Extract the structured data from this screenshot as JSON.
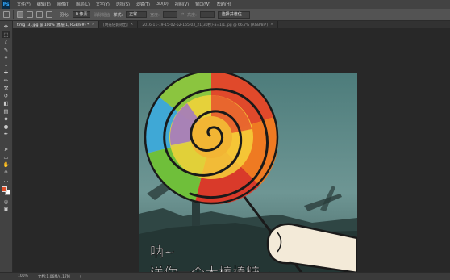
{
  "app": {
    "logo_text": "Ps"
  },
  "menu": [
    "文件(F)",
    "编辑(E)",
    "图像(I)",
    "图层(L)",
    "文字(Y)",
    "选择(S)",
    "滤镜(T)",
    "3D(D)",
    "视图(V)",
    "窗口(W)",
    "帮助(H)"
  ],
  "options_bar": {
    "feather_label": "羽化:",
    "feather_value": "0 像素",
    "antialias_label": "消除锯齿",
    "style_label": "样式:",
    "style_value": "正常",
    "width_label": "宽度:",
    "height_label": "高度:",
    "select_mask_button": "选择并遮住..."
  },
  "tabs": [
    {
      "label": "timg (3).jpg @ 100% (图层 1, RGB/8#) *",
      "active": true
    },
    {
      "label": "[明光倍影效出]",
      "active": false
    },
    {
      "label": "2016-11-19-15-02-52-165-03_21(30秒)-a=1/1.jpg @ 66.7% (RGB/8#)",
      "active": false
    }
  ],
  "toolbar": {
    "tools": [
      {
        "name": "move-tool",
        "glyph": "✥"
      },
      {
        "name": "marquee-tool",
        "glyph": "⬚"
      },
      {
        "name": "lasso-tool",
        "glyph": "ℓ"
      },
      {
        "name": "quick-select-tool",
        "glyph": "✎"
      },
      {
        "name": "crop-tool",
        "glyph": "⌗"
      },
      {
        "name": "eyedropper-tool",
        "glyph": "⌁"
      },
      {
        "name": "healing-brush-tool",
        "glyph": "✚"
      },
      {
        "name": "brush-tool",
        "glyph": "✏"
      },
      {
        "name": "clone-stamp-tool",
        "glyph": "⚒"
      },
      {
        "name": "history-brush-tool",
        "glyph": "↺"
      },
      {
        "name": "eraser-tool",
        "glyph": "◧"
      },
      {
        "name": "gradient-tool",
        "glyph": "▤"
      },
      {
        "name": "blur-tool",
        "glyph": "◆"
      },
      {
        "name": "dodge-tool",
        "glyph": "●"
      },
      {
        "name": "pen-tool",
        "glyph": "✒"
      },
      {
        "name": "type-tool",
        "glyph": "T"
      },
      {
        "name": "path-select-tool",
        "glyph": "➤"
      },
      {
        "name": "shape-tool",
        "glyph": "▭"
      },
      {
        "name": "hand-tool",
        "glyph": "✋"
      },
      {
        "name": "zoom-tool",
        "glyph": "⚲"
      },
      {
        "name": "extra-tools",
        "glyph": "…"
      }
    ],
    "bottom_tools": [
      {
        "name": "quick-mask-icon",
        "glyph": "◎"
      },
      {
        "name": "screen-mode-icon",
        "glyph": "▣"
      }
    ],
    "foreground_color": "#e0502a",
    "background_color": "#ffffff"
  },
  "canvas": {
    "caption_line1": "呐~",
    "caption_line2": "送你一个大棒棒糖~"
  },
  "status_bar": {
    "zoom": "100%",
    "doc_info": "文档:1.06M/4.17M"
  }
}
